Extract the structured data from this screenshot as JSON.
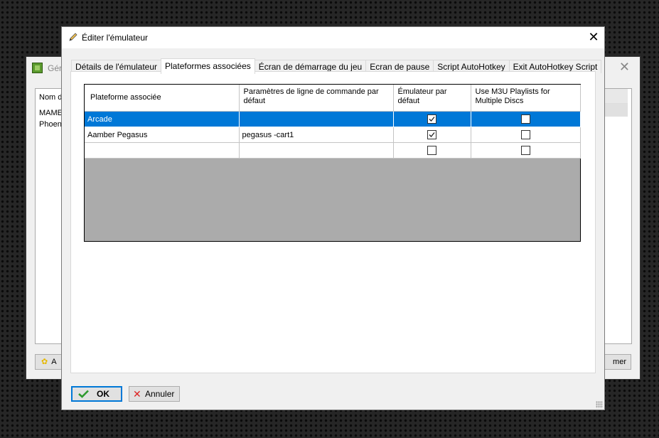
{
  "background_window": {
    "title": "Géré",
    "list_header": "Nom d",
    "rows": [
      "MAME",
      "Phoen"
    ],
    "add_label": "A",
    "close_label": "mer"
  },
  "dialog": {
    "title": "Éditer l'émulateur",
    "close_glyph": "✕"
  },
  "tabs": [
    {
      "label": "Détails de l'émulateur",
      "active": false
    },
    {
      "label": "Plateformes associées",
      "active": true
    },
    {
      "label": "Écran de démarrage du jeu",
      "active": false
    },
    {
      "label": "Ecran de pause",
      "active": false
    },
    {
      "label": "Script AutoHotkey",
      "active": false
    },
    {
      "label": "Exit AutoHotkey Script",
      "active": false
    }
  ],
  "grid": {
    "columns": [
      "Plateforme associée",
      "Paramètres de ligne de commande par défaut",
      "Émulateur par défaut",
      "Use M3U Playlists for Multiple Discs"
    ],
    "rows": [
      {
        "platform": "Arcade",
        "params": "",
        "default_emulator": true,
        "use_m3u": false,
        "selected": true
      },
      {
        "platform": "Aamber Pegasus",
        "params": "pegasus -cart1",
        "default_emulator": true,
        "use_m3u": false,
        "selected": false
      },
      {
        "platform": "",
        "params": "",
        "default_emulator": false,
        "use_m3u": false,
        "selected": false
      }
    ]
  },
  "buttons": {
    "ok_label": "OK",
    "cancel_label": "Annuler"
  },
  "colors": {
    "selection": "#0078d7",
    "grid_empty": "#ababab",
    "ok_border": "#0078d7",
    "ok_icon": "#2e9a2e",
    "cancel_icon": "#d22222"
  }
}
